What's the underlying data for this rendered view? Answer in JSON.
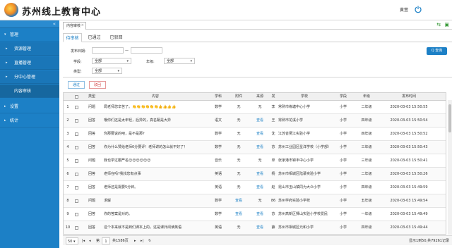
{
  "header": {
    "app_title": "苏州线上教育中心",
    "user_name": "黄萱",
    "power_icon": "power-icon"
  },
  "sidebar": {
    "collapse_label": "«",
    "items": [
      {
        "label": "管理",
        "level": 1,
        "arrow": "▾"
      },
      {
        "label": "资源管理",
        "level": 2,
        "arrow": "▸"
      },
      {
        "label": "直播管理",
        "level": 2,
        "arrow": "▸"
      },
      {
        "label": "分中心管理",
        "level": 2,
        "arrow": "▸"
      },
      {
        "label": "内容审核",
        "level": 2,
        "arrow": "",
        "selected": true
      },
      {
        "label": "设置",
        "level": 1,
        "arrow": "▸"
      },
      {
        "label": "统计",
        "level": 1,
        "arrow": "▸"
      }
    ]
  },
  "tabs": {
    "active": "内容审核",
    "close": "×",
    "refresh_icon": "⇆",
    "fullscreen_icon": "▣"
  },
  "subtabs": [
    "待审核",
    "已通过",
    "已驳回"
  ],
  "filters": {
    "date_label": "发布日期:",
    "date_sep": "—",
    "stage_label": "学段:",
    "stage_value": "全部",
    "grade_label": "年级:",
    "grade_value": "全部",
    "type_label": "类型:",
    "type_value": "全部",
    "query_button": "Q 查询"
  },
  "actions": {
    "pass": "通过",
    "reject": "驳回"
  },
  "table": {
    "headers": [
      "",
      "类型",
      "内容",
      "学科",
      "附件",
      "来源",
      "发",
      "学校",
      "学段",
      "年级",
      "发布时间"
    ],
    "rows": [
      {
        "n": "1",
        "type": "问题",
        "content": "局老师您辛苦了。👏👏👏👏👏👏👍👍👍👍",
        "subject": "数学",
        "attach": "无",
        "source": "无",
        "pub": "李",
        "school": "常熟市练塘中心小学",
        "stage": "小学",
        "grade": "二年级",
        "time": "2020-03-03 15:50:55"
      },
      {
        "n": "2",
        "type": "回答",
        "content": "哦你们还是太年轻，后异的，真名甄是大异",
        "subject": "语文",
        "attach": "无",
        "source": "查看",
        "pub": "王",
        "school": "常熟市花溪小学",
        "stage": "小学",
        "grade": "四年级",
        "time": "2020-03-03 15:50:54"
      },
      {
        "n": "3",
        "type": "回答",
        "content": "你那要说的吧，是不是那?",
        "subject": "数学",
        "attach": "无",
        "source": "查看",
        "pub": "沈",
        "school": "江苏省吴江实验小学",
        "stage": "小学",
        "grade": "四年级",
        "time": "2020-03-03 15:50:52"
      },
      {
        "n": "4",
        "type": "回答",
        "content": "你为什么赞给老师0分要评！老师讲的怎么就不好了！",
        "subject": "数学",
        "attach": "无",
        "source": "查看",
        "pub": "苏",
        "school": "苏州工业园区星洋学校（小学部）",
        "stage": "小学",
        "grade": "三年级",
        "time": "2020-03-03 15:50:43"
      },
      {
        "n": "5",
        "type": "问题",
        "content": "我也学过跟严名😊😊😊😊😊😊",
        "subject": "音乐",
        "attach": "无",
        "source": "无",
        "pub": "单",
        "school": "张家港市锦丰中心小学",
        "stage": "小学",
        "grade": "三年级",
        "time": "2020-03-03 15:50:41"
      },
      {
        "n": "6",
        "type": "回答",
        "content": "老师在吗?我找您有点事",
        "subject": "英语",
        "attach": "无",
        "source": "查看",
        "pub": "杨",
        "school": "苏州市相城区陆慕实验小学",
        "stage": "小学",
        "grade": "二年级",
        "time": "2020-03-03 15:50:26"
      },
      {
        "n": "7",
        "type": "回答",
        "content": "老师还是需要5分钟。",
        "subject": "英语",
        "attach": "无",
        "source": "查看",
        "pub": "赵",
        "school": "昆山市玉山镇同为大众小学",
        "stage": "小学",
        "grade": "四年级",
        "time": "2020-03-03 15:49:59"
      },
      {
        "n": "8",
        "type": "问题",
        "content": "求解",
        "subject": "数学",
        "attach": "查看",
        "source": "无",
        "pub": "86",
        "school": "苏州学府实验小学校",
        "stage": "小学",
        "grade": "五年级",
        "time": "2020-03-03 15:49:54"
      },
      {
        "n": "9",
        "type": "回答",
        "content": "你的答案是对的。",
        "subject": "数学",
        "attach": "查看",
        "source": "查看",
        "pub": "苏",
        "school": "苏州高新区狮山实验小学校爱民",
        "stage": "小学",
        "grade": "一年级",
        "time": "2020-03-03 15:49:49"
      },
      {
        "n": "10",
        "type": "回答",
        "content": "这个本来就不是到们课本上的，这是课外阅读英语",
        "subject": "英语",
        "attach": "无",
        "source": "查看",
        "pub": "薛",
        "school": "苏州市相城区元和小学",
        "stage": "小学",
        "grade": "四年级",
        "time": "2020-03-03 15:49:44"
      }
    ]
  },
  "pager": {
    "page_size": "50 ▾",
    "first": "|◂",
    "prev": "◂",
    "page_label": "第",
    "page_num": "1",
    "page_total": "共1586页",
    "next": "▸",
    "last": "▸|",
    "refresh": "↻",
    "summary": "显示1到50,共79261记录"
  }
}
